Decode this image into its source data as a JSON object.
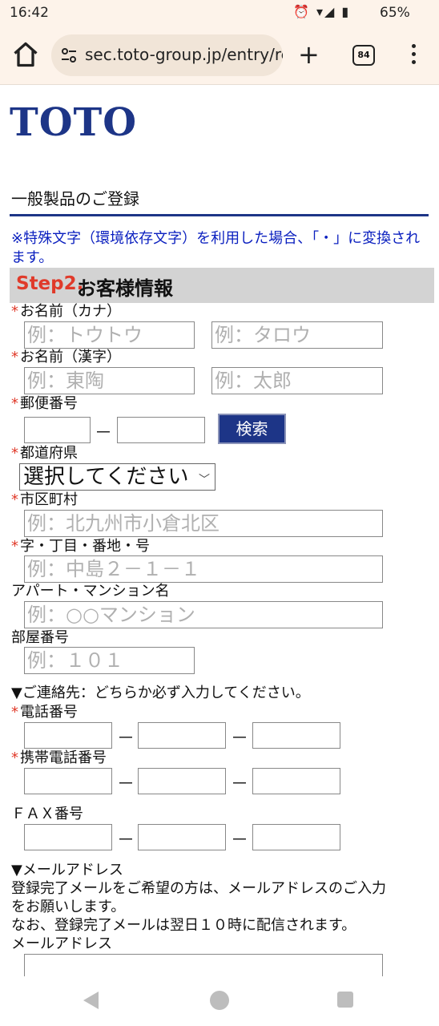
{
  "status": {
    "time": "16:42",
    "icons": "⏰ ▾◢ ▮",
    "battery": "65%"
  },
  "browser": {
    "url": "sec.toto-group.jp/entry/re",
    "tab_count": "84",
    "newtab_label": "+"
  },
  "logo": "TOTO",
  "page": {
    "title": "一般製品のご登録",
    "notice": "※特殊文字（環境依存文字）を利用した場合、「・」に変換されます。",
    "step_prefix": "Step2.",
    "step_title": "お客様情報"
  },
  "form": {
    "req_mark": "*",
    "dash": "－",
    "kana": {
      "label": "お名前（カナ）",
      "last_ph": "例：トウトウ",
      "first_ph": "例：タロウ"
    },
    "kanji": {
      "label": "お名前（漢字）",
      "last_ph": "例：東陶",
      "first_ph": "例：太郎"
    },
    "postal": {
      "label": "郵便番号",
      "search_label": "検索"
    },
    "prefecture": {
      "label": "都道府県",
      "selected": "選択してください"
    },
    "city": {
      "label": "市区町村",
      "ph": "例：北九州市小倉北区"
    },
    "address": {
      "label": "字・丁目・番地・号",
      "ph": "例：中島２－１－１"
    },
    "building": {
      "label": "アパート・マンション名",
      "ph": "例：○○マンション"
    },
    "room": {
      "label": "部屋番号",
      "ph": "例：１０１"
    },
    "contact_heading": "▼ご連絡先：どちらか必ず入力してください。",
    "phone": {
      "label": "電話番号"
    },
    "mobile": {
      "label": "携帯電話番号"
    },
    "fax": {
      "label": "ＦＡＸ番号"
    },
    "mail_heading": "▼メールアドレス",
    "mail_note1": "登録完了メールをご希望の方は、メールアドレスのご入力",
    "mail_note2": "をお願いします。",
    "mail_note3": "なお、登録完了メールは翌日１０時に配信されます。",
    "mail": {
      "label": "メールアドレス"
    }
  }
}
